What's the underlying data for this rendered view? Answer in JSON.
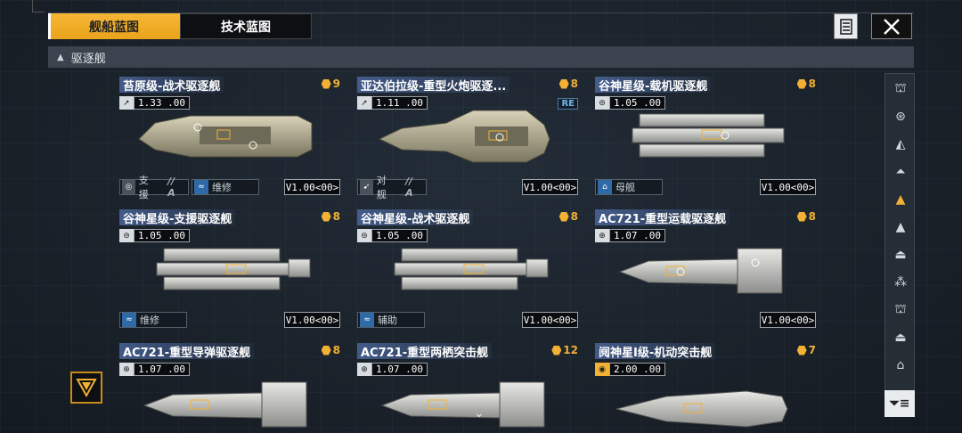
{
  "tabs": [
    {
      "label": "舰船蓝图",
      "active": true
    },
    {
      "label": "技术蓝图",
      "active": false
    }
  ],
  "section": {
    "label": "驱逐舰"
  },
  "colors": {
    "accent": "#f2b134",
    "card_name_bg": "#506eaa",
    "tag_blue": "#2f6aa8"
  },
  "cards": [
    {
      "name": "苔原级-战术驱逐舰",
      "slots": "9",
      "cost_icon": "fighter-icon",
      "cost": "1.33 .00",
      "tags": [
        {
          "icon": "support-icon",
          "label": "支援",
          "grade": "// A",
          "style": "grey"
        },
        {
          "icon": "repair-icon",
          "label": "维修",
          "style": "blue"
        }
      ],
      "version": "V1.00<00>"
    },
    {
      "name": "亚达伯拉级-重型火炮驱逐...",
      "slots": "8",
      "cost_icon": "fighter-icon",
      "cost": "1.11 .00",
      "re": "RE",
      "tags": [
        {
          "icon": "artillery-icon",
          "label": "对舰",
          "grade": "// A",
          "style": "grey"
        }
      ],
      "version": "V1.00<00>"
    },
    {
      "name": "谷神星级-载机驱逐舰",
      "slots": "8",
      "cost_icon": "carrier-icon",
      "cost": "1.05 .00",
      "tags": [
        {
          "icon": "mothership-icon",
          "label": "母舰",
          "style": "blue"
        }
      ],
      "version": "V1.00<00>"
    },
    {
      "name": "谷神星级-支援驱逐舰",
      "slots": "8",
      "cost_icon": "carrier-icon",
      "cost": "1.05 .00",
      "tags": [
        {
          "icon": "repair-icon",
          "label": "维修",
          "style": "blue"
        }
      ],
      "version": "V1.00<00>"
    },
    {
      "name": "谷神星级-战术驱逐舰",
      "slots": "8",
      "cost_icon": "carrier-icon",
      "cost": "1.05 .00",
      "tags": [
        {
          "icon": "assist-icon",
          "label": "辅助",
          "style": "blue"
        }
      ],
      "version": "V1.00<00>"
    },
    {
      "name": "AC721-重型运载驱逐舰",
      "slots": "8",
      "cost_icon": "globe-icon",
      "cost": "1.07 .00",
      "tags": [],
      "version": "V1.00<00>"
    },
    {
      "name": "AC721-重型导弹驱逐舰",
      "slots": "8",
      "cost_icon": "globe-icon",
      "cost": "1.07 .00",
      "tags": [],
      "version": ""
    },
    {
      "name": "AC721-重型两栖突击舰",
      "slots": "12",
      "cost_icon": "globe-icon",
      "cost": "1.07 .00",
      "tags": [],
      "version": ""
    },
    {
      "name": "阋神星Ⅰ级-机动突击舰",
      "slots": "7",
      "cost_icon": "coin-icon",
      "cost": "2.00 .00",
      "tags": [],
      "version": ""
    }
  ],
  "sidebar": {
    "items": [
      {
        "icon": "battleship-icon"
      },
      {
        "icon": "cruiser-icon"
      },
      {
        "icon": "frigate-icon"
      },
      {
        "icon": "corvette-icon"
      },
      {
        "icon": "destroyer-icon",
        "active": true
      },
      {
        "icon": "fighter-class-icon"
      },
      {
        "icon": "carrier-class-icon"
      },
      {
        "icon": "support-class-icon"
      },
      {
        "icon": "auxiliary-icon"
      },
      {
        "icon": "special-icon"
      },
      {
        "icon": "other-icon"
      }
    ],
    "filter_icon": "filter-icon"
  }
}
